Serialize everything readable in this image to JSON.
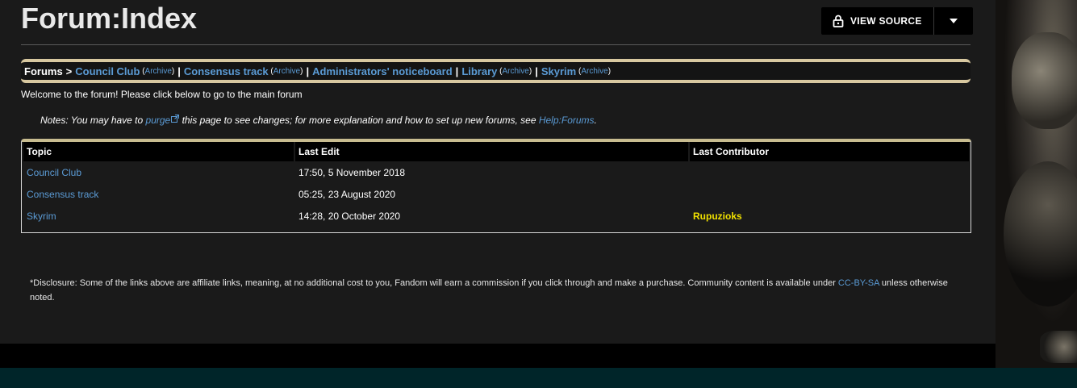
{
  "page": {
    "title": "Forum:Index"
  },
  "toolbar": {
    "view_source_label": "VIEW SOURCE"
  },
  "breadcrumb": {
    "root": "Forums",
    "arrow": ">",
    "items": [
      {
        "label": "Council Club",
        "archive": "Archive"
      },
      {
        "label": "Consensus track",
        "archive": "Archive"
      },
      {
        "label": "Administrators' noticeboard"
      },
      {
        "label": "Library",
        "archive": "Archive"
      },
      {
        "label": "Skyrim",
        "archive": "Archive"
      }
    ]
  },
  "welcome": "Welcome to the forum! Please click below to go to the main forum",
  "notes": {
    "prefix": "Notes: You may have to ",
    "purge_link": "purge",
    "middle": " this page to see changes; for more explanation and how to set up new forums, see ",
    "help_link": "Help:Forums",
    "suffix": "."
  },
  "table": {
    "headers": [
      "Topic",
      "Last Edit",
      "Last Contributor"
    ],
    "rows": [
      {
        "topic": "Council Club",
        "last_edit": "17:50, 5 November 2018",
        "contributor": ""
      },
      {
        "topic": "Consensus track",
        "last_edit": "05:25, 23 August 2020",
        "contributor": ""
      },
      {
        "topic": "Skyrim",
        "last_edit": "14:28, 20 October 2020",
        "contributor": "Rupuzioks"
      }
    ]
  },
  "disclosure": {
    "text": "*Disclosure: Some of the links above are affiliate links, meaning, at no additional cost to you, Fandom will earn a commission if you click through and make a purchase. Community content is available under ",
    "license_link": "CC-BY-SA",
    "suffix": " unless otherwise noted."
  },
  "colors": {
    "link": "#5b9bd5",
    "contributor": "#f0e000",
    "crumb_border": "#d8c8a0",
    "footer_bar": "#002529"
  },
  "icons": {
    "view_source": "lock-icon",
    "dropdown": "caret-down-icon",
    "external": "external-link-icon"
  }
}
